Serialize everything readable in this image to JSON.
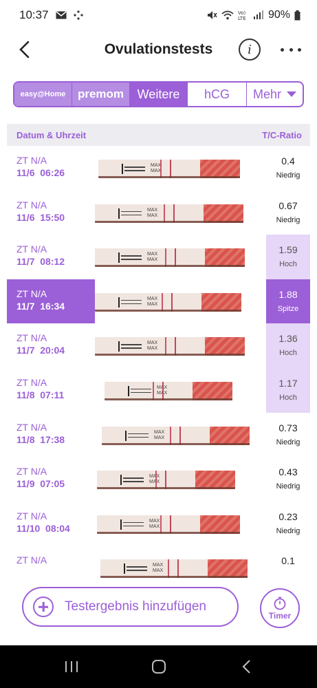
{
  "status_bar": {
    "time": "10:37",
    "battery": "90%"
  },
  "header": {
    "title": "Ovulationstests",
    "info_glyph": "i"
  },
  "tabs": [
    {
      "label": "easy@Home",
      "active": false
    },
    {
      "label": "premom",
      "active": false
    },
    {
      "label": "Weitere",
      "active": true
    },
    {
      "label": "hCG",
      "active": false
    },
    {
      "label": "Mehr",
      "active": false
    }
  ],
  "table": {
    "col_date": "Datum & Uhrzeit",
    "col_ratio": "T/C-Ratio",
    "rows": [
      {
        "zt": "ZT N/A",
        "datetime": "11/6  06:26",
        "ratio": "0.4",
        "level": "Niedrig",
        "state": "low"
      },
      {
        "zt": "ZT N/A",
        "datetime": "11/6  15:50",
        "ratio": "0.67",
        "level": "Niedrig",
        "state": "low"
      },
      {
        "zt": "ZT N/A",
        "datetime": "11/7  08:12",
        "ratio": "1.59",
        "level": "Hoch",
        "state": "high"
      },
      {
        "zt": "ZT N/A",
        "datetime": "11/7  16:34",
        "ratio": "1.88",
        "level": "Spitze",
        "state": "peak"
      },
      {
        "zt": "ZT N/A",
        "datetime": "11/7  20:04",
        "ratio": "1.36",
        "level": "Hoch",
        "state": "high"
      },
      {
        "zt": "ZT N/A",
        "datetime": "11/8  07:11",
        "ratio": "1.17",
        "level": "Hoch",
        "state": "high"
      },
      {
        "zt": "ZT N/A",
        "datetime": "11/8  17:38",
        "ratio": "0.73",
        "level": "Niedrig",
        "state": "low"
      },
      {
        "zt": "ZT N/A",
        "datetime": "11/9  07:05",
        "ratio": "0.43",
        "level": "Niedrig",
        "state": "low"
      },
      {
        "zt": "ZT N/A",
        "datetime": "11/10  08:04",
        "ratio": "0.23",
        "level": "Niedrig",
        "state": "low"
      },
      {
        "zt": "ZT N/A",
        "datetime": "",
        "ratio": "0.1",
        "level": "",
        "state": "low"
      }
    ]
  },
  "strip_text": "MAX",
  "actions": {
    "add_label": "Testergebnis hinzufügen",
    "timer_label": "Timer"
  },
  "colors": {
    "accent": "#9b5fd7",
    "highlight": "#e6d6f7",
    "strip_handle": "#d9544b"
  }
}
